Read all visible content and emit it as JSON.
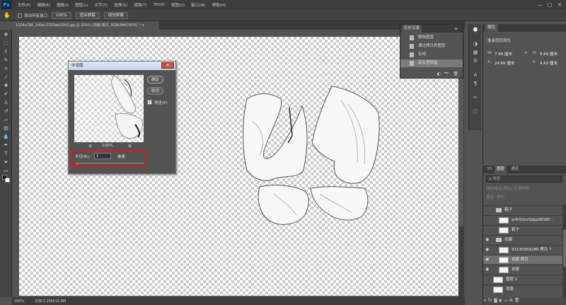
{
  "app": {
    "logo": "Ps"
  },
  "menu": [
    "文件(F)",
    "编辑(E)",
    "图像(I)",
    "图层(L)",
    "文字(Y)",
    "选择(S)",
    "滤镜(T)",
    "3D(D)",
    "视图(V)",
    "窗口(W)",
    "帮助(H)"
  ],
  "window_controls": {
    "minimize": "—",
    "maximize": "□",
    "close": "✕"
  },
  "options_bar": {
    "scroll_all_windows": "滚动所有窗口",
    "zoom_button": "100%",
    "fit_screen_button": "适合屏幕",
    "fill_screen_button": "填充屏幕"
  },
  "document_tab": {
    "title": "1024x768_2d0ec2333ab16b3.jpg @ 200% (衣服 拷贝, RGB/8#/CMYK) *",
    "close": "×"
  },
  "status_bar": {
    "zoom": "200%",
    "doc_size": "文档:2.25M/15.9M"
  },
  "filter_dialog": {
    "title": "中间值",
    "ok": "确定",
    "cancel": "取消",
    "preview_label": "预览(P)",
    "preview_checked": true,
    "zoom_out": "⊖",
    "zoom_percent": "100%",
    "zoom_in": "⊕",
    "radius_label": "半径(R):",
    "radius_value": "1",
    "radius_unit": "像素",
    "close": "✕"
  },
  "history_panel": {
    "tab": "历史记录",
    "menu": "≡",
    "items": [
      {
        "label": "删除图层",
        "active": false
      },
      {
        "label": "通过拷贝的图层",
        "active": false
      },
      {
        "label": "反相",
        "active": false
      },
      {
        "label": "高反差保留",
        "active": true
      }
    ],
    "footer_icons": [
      "◐",
      "📷",
      "🗑"
    ]
  },
  "properties_panel": {
    "tab": "属性",
    "subtitle": "像素图层属性",
    "w_label": "W:",
    "w_value": "7.66 厘米",
    "h_label": "H:",
    "h_value": "8.64 厘米",
    "x_label": "X:",
    "x_value": "24.66 厘米",
    "y_label": "Y:",
    "y_value": "4.62 厘米"
  },
  "layers_panel": {
    "tabs": [
      "3D",
      "图层",
      "通道"
    ],
    "filter_label": "p 类型",
    "blend_label": "线性减淡(添加)   不透明度:",
    "lock_label": "锁定:                 填充:",
    "layers": [
      {
        "type": "group",
        "name": "鞋子",
        "visible": false,
        "selected": false,
        "indent": 1
      },
      {
        "type": "layer",
        "name": "w4t5QsVQdjaSES8F...",
        "visible": false,
        "selected": false,
        "indent": 2
      },
      {
        "type": "layer",
        "name": "鞋子",
        "visible": false,
        "selected": false,
        "indent": 2
      },
      {
        "type": "group",
        "name": "衣服",
        "visible": true,
        "selected": false,
        "indent": 1
      },
      {
        "type": "layer",
        "name": "92135959286 拷贝 7",
        "visible": true,
        "selected": false,
        "indent": 2
      },
      {
        "type": "layer",
        "name": "衣服 拷贝",
        "visible": true,
        "selected": true,
        "indent": 2
      },
      {
        "type": "layer",
        "name": "衣服",
        "visible": true,
        "selected": false,
        "indent": 2
      },
      {
        "type": "layer",
        "name": "图层 1",
        "visible": false,
        "selected": false,
        "indent": 1
      },
      {
        "type": "layer",
        "name": "背景",
        "visible": false,
        "selected": false,
        "indent": 1
      }
    ],
    "footer": "∞  fx  ◙  ◐  ▭  ⊞  🗑"
  },
  "colors": {
    "ui_bg": "#535353",
    "dark_bar": "#3c3c3c",
    "highlight_red": "#d21e1e",
    "ps_blue": "#31a8ff"
  }
}
